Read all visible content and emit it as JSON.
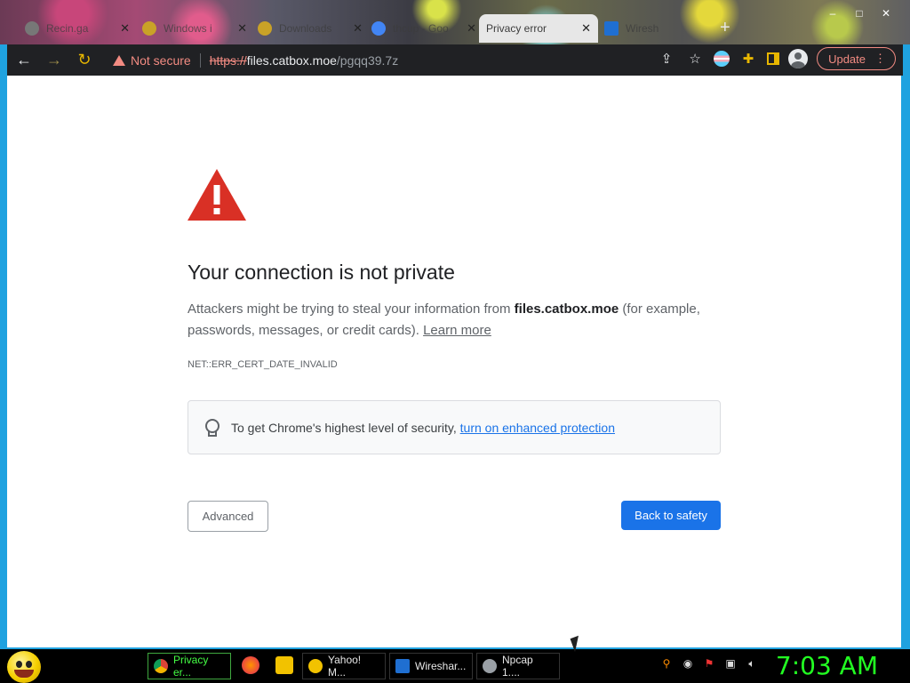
{
  "browser": {
    "tabs": [
      {
        "title": "Recin.ga",
        "favicon_color": "#777777"
      },
      {
        "title": "Windows i",
        "favicon_color": "#c9a227"
      },
      {
        "title": "Downloads",
        "favicon_color": "#c9a227"
      },
      {
        "title": "thcup - Goo",
        "favicon_color": "#4285f4"
      },
      {
        "title": "Privacy error",
        "favicon_color": "#e7e7e7",
        "active": true
      },
      {
        "title": "Wiresh",
        "favicon_color": "#1f6fd1"
      }
    ],
    "new_tab_symbol": "+",
    "window_buttons": {
      "minimize": "–",
      "maximize": "□",
      "close": "✕"
    }
  },
  "toolbar": {
    "back_icon": "←",
    "forward_icon": "→",
    "reload_icon": "↻",
    "security_label": "Not secure",
    "url_scheme": "https://",
    "url_host": "files.catbox.moe",
    "url_path": "/pgqq39.7z",
    "share_icon": "⇪",
    "bookmark_icon": "☆",
    "update_label": "Update",
    "menu_icon": "⋮"
  },
  "page": {
    "title": "Your connection is not private",
    "explain_prefix": "Attackers might be trying to steal your information from ",
    "explain_host": "files.catbox.moe",
    "explain_suffix": " (for example, passwords, messages, or credit cards). ",
    "learn_more": "Learn more",
    "error_code": "NET::ERR_CERT_DATE_INVALID",
    "enhanced_prefix": "To get Chrome's highest level of security, ",
    "enhanced_link": "turn on enhanced protection",
    "advanced_button": "Advanced",
    "back_button": "Back to safety",
    "warning_color": "#d93025",
    "accent_color": "#1a73e8"
  },
  "taskbar": {
    "tasks": [
      {
        "label": "Privacy er...",
        "icon_color": "#4285f4",
        "active": true
      },
      {
        "label": "Yahoo! M...",
        "icon_color": "#f2c200"
      },
      {
        "label": "Wireshar...",
        "icon_color": "#1f6fd1"
      },
      {
        "label": "Npcap 1....",
        "icon_color": "#9aa0a6"
      }
    ],
    "clock": "7:03 AM"
  }
}
